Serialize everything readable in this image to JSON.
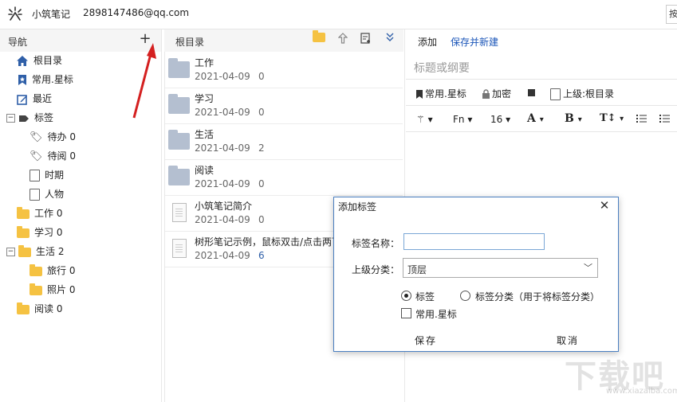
{
  "topbar": {
    "app_title": "小筑笔记",
    "account": "2898147486@qq.com",
    "search_fragment": "按"
  },
  "nav": {
    "title": "导航",
    "add_label": "+",
    "items": [
      {
        "label": "根目录",
        "icon": "home-icon"
      },
      {
        "label": "常用.星标",
        "icon": "bookmark-star-icon"
      },
      {
        "label": "最近",
        "icon": "edit-icon"
      },
      {
        "label": "标签",
        "icon": "tag-icon",
        "expander": "−"
      },
      {
        "label": "待办 0",
        "icon": "tag-outline-icon"
      },
      {
        "label": "待阅 0",
        "icon": "tag-outline-icon"
      },
      {
        "label": "时期",
        "icon": "page-icon"
      },
      {
        "label": "人物",
        "icon": "page-icon"
      },
      {
        "label": "工作 0",
        "icon": "folder-icon"
      },
      {
        "label": "学习 0",
        "icon": "folder-icon"
      },
      {
        "label": "生活 2",
        "icon": "folder-icon",
        "expander": "−"
      },
      {
        "label": "旅行 0",
        "icon": "folder-icon"
      },
      {
        "label": "照片 0",
        "icon": "folder-icon"
      },
      {
        "label": "阅读 0",
        "icon": "folder-icon"
      }
    ]
  },
  "list": {
    "title": "根目录",
    "tools": [
      "folder-icon",
      "arrow-up-icon",
      "new-note-icon",
      "expand-down-icon"
    ],
    "rows": [
      {
        "title": "工作",
        "date": "2021-04-09",
        "count": "0",
        "type": "folder"
      },
      {
        "title": "学习",
        "date": "2021-04-09",
        "count": "0",
        "type": "folder"
      },
      {
        "title": "生活",
        "date": "2021-04-09",
        "count": "2",
        "type": "folder"
      },
      {
        "title": "阅读",
        "date": "2021-04-09",
        "count": "0",
        "type": "folder"
      },
      {
        "title": "小筑笔记简介",
        "date": "2021-04-09",
        "count": "0",
        "type": "doc"
      },
      {
        "title": "树形笔记示例，鼠标双击/点击两下",
        "date": "2021-04-09",
        "count": "6",
        "type": "doc"
      }
    ]
  },
  "editor": {
    "add_label": "添加",
    "save_new_label": "保存并新建",
    "title_placeholder": "标题或纲要",
    "star_label": "常用.星标",
    "lock_label": "加密",
    "parent_label": "上级:根目录",
    "font_label": "Fn",
    "size_label": "16",
    "colors": {
      "link": "#1a55b8"
    }
  },
  "dialog": {
    "title": "添加标签",
    "close": "✕",
    "name_label": "标签名称：",
    "name_value": "",
    "parent_label": "上级分类：",
    "parent_value": "顶层",
    "radio_tag": "标签",
    "radio_category": "标签分类（用于将标签分类）",
    "check_star": "常用.星标",
    "save": "保存",
    "cancel": "取消"
  },
  "watermark": {
    "text": "下载吧",
    "url": "www.xiazaiba.com"
  }
}
